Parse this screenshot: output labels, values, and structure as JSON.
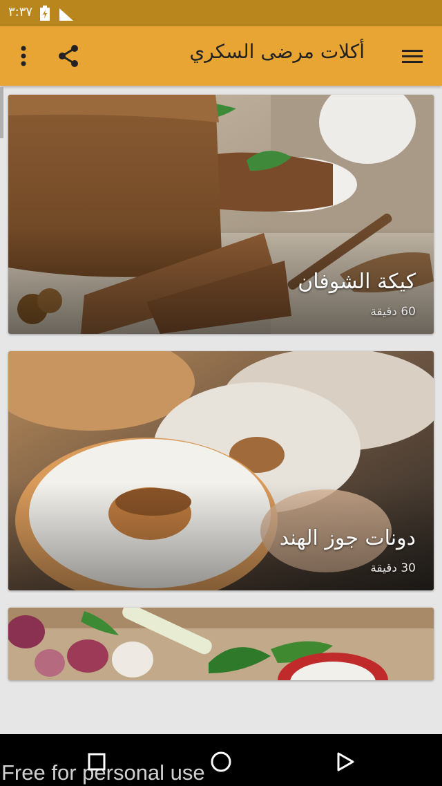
{
  "status_bar": {
    "time": "٣:٣٧"
  },
  "app_bar": {
    "title": "أكلات مرضى السكري"
  },
  "recipes": [
    {
      "title": "كيكة الشوفان",
      "time": "60 دقيقة"
    },
    {
      "title": "دونات جوز الهند",
      "time": "30 دقيقة"
    },
    {
      "title": "",
      "time": ""
    }
  ],
  "watermark": "Free for personal use",
  "icons": [
    "menu-icon",
    "share-icon",
    "more-vert-icon",
    "battery-icon",
    "signal-icon",
    "recent-apps-icon",
    "home-icon",
    "back-icon"
  ],
  "colors": {
    "app_bar": "#e8a533",
    "status_bar": "#b8861d"
  }
}
